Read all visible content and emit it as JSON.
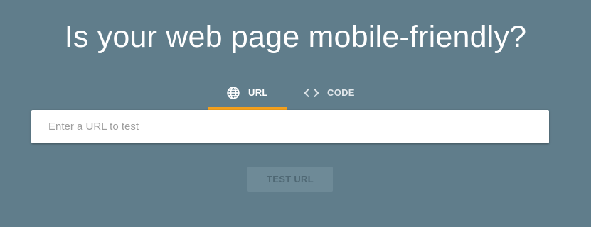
{
  "header": {
    "title": "Is your web page mobile-friendly?"
  },
  "tabs": [
    {
      "label": "URL",
      "icon": "globe-icon",
      "active": true
    },
    {
      "label": "CODE",
      "icon": "code-icon",
      "active": false
    }
  ],
  "form": {
    "url_input_placeholder": "Enter a URL to test",
    "url_input_value": "",
    "submit_label": "TEST URL",
    "submit_disabled": true
  },
  "colors": {
    "background": "#607d8b",
    "tab_indicator": "#f4a01c",
    "button_disabled_bg": "#6e8a97"
  }
}
